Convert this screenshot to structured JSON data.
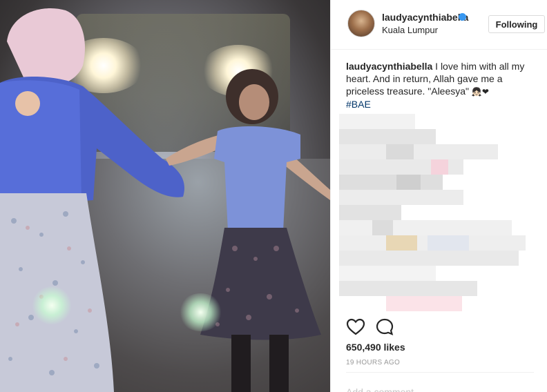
{
  "post": {
    "username": "laudyacynthiabella",
    "location": "Kuala Lumpur",
    "follow_label": "Following",
    "caption_user": "laudyacynthiabella",
    "caption_text": " I love him with all my heart. And in return, Allah gave me a priceless treasure. \"Aleesya\" ",
    "caption_emoji": "👧🏻❤",
    "hashtag": "#BAE",
    "likes": "650,490 likes",
    "timestamp": "19 HOURS AGO",
    "comment_placeholder": "Add a comment..."
  },
  "icons": {
    "like": "heart-outline-icon",
    "comment": "speech-bubble-icon",
    "verified": "verified-badge-icon"
  },
  "colors": {
    "text": "#262626",
    "hashtag": "#003569",
    "verified": "#3897f0",
    "meta": "#999999"
  }
}
